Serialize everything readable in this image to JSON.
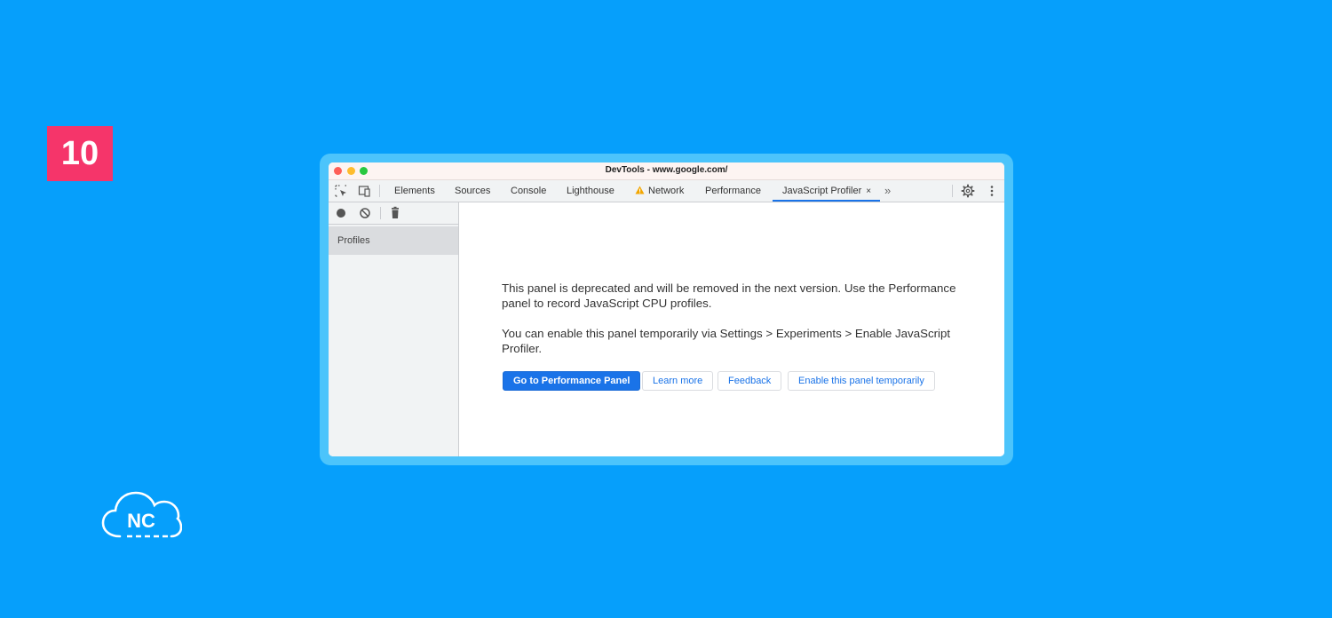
{
  "step_badge": "10",
  "logo_text": "NC",
  "window": {
    "title": "DevTools - www.google.com/"
  },
  "toolbar": {
    "tabs": [
      {
        "label": "Elements"
      },
      {
        "label": "Sources"
      },
      {
        "label": "Console"
      },
      {
        "label": "Lighthouse"
      },
      {
        "label": "Network",
        "icon": "warning-icon"
      },
      {
        "label": "Performance"
      },
      {
        "label": "JavaScript Profiler",
        "active": true,
        "closable": true
      }
    ],
    "close_glyph": "×",
    "more_glyph": "»"
  },
  "sidebar": {
    "items": [
      {
        "label": "Profiles"
      }
    ]
  },
  "content": {
    "paragraph1": "This panel is deprecated and will be removed in the next version. Use the Performance panel to record JavaScript CPU profiles.",
    "paragraph2": "You can enable this panel temporarily via Settings > Experiments > Enable JavaScript Profiler.",
    "buttons": {
      "primary": "Go to Performance Panel",
      "learn_more": "Learn more",
      "feedback": "Feedback",
      "enable": "Enable this panel temporarily"
    }
  },
  "colors": {
    "background": "#069ffb",
    "badge": "#f5356a",
    "frame": "#4cc4fb",
    "accent": "#1a73e8",
    "close": "#fe5f57",
    "minimize": "#febc2e",
    "maximize": "#28c840"
  }
}
